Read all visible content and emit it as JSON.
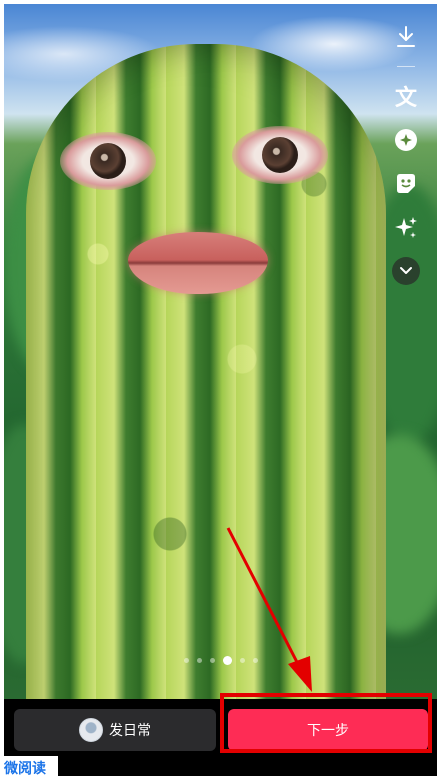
{
  "icons": {
    "download": "download-icon",
    "text": "text-icon",
    "sticker": "sticker-icon",
    "emoji": "emoji-sticker-icon",
    "effects": "sparkle-effects-icon",
    "more": "chevron-down-icon"
  },
  "side_toolbar": {
    "text_label": "文"
  },
  "pager": {
    "total": 6,
    "active_index": 3
  },
  "bottom": {
    "daily_label": "发日常",
    "next_label": "下一步"
  },
  "colors": {
    "accent": "#fe2c55",
    "highlight": "#e30000",
    "arrow": "#e30000",
    "dark_button": "#2b2b2d"
  },
  "watermark": {
    "text": "微阅读"
  }
}
